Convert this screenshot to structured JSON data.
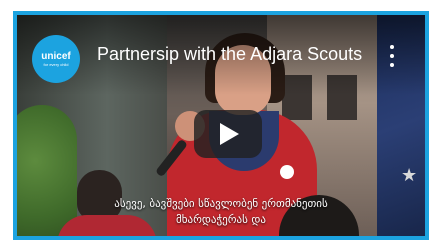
{
  "video": {
    "channel_logo": {
      "main_text": "unicef",
      "sub_text": "for every child",
      "color": "#1ca3e0"
    },
    "title": "Partnersip with the Adjara Scouts",
    "menu_icon": "more-vert-icon",
    "play_icon": "play-icon",
    "subtitle_lines": [
      "ასევე, ბავშვები სწავლობენ ერთმანეთის",
      "მხარდაჭერას და"
    ]
  },
  "colors": {
    "frame": "#1ca3e0",
    "play_button_bg": "#212121"
  }
}
